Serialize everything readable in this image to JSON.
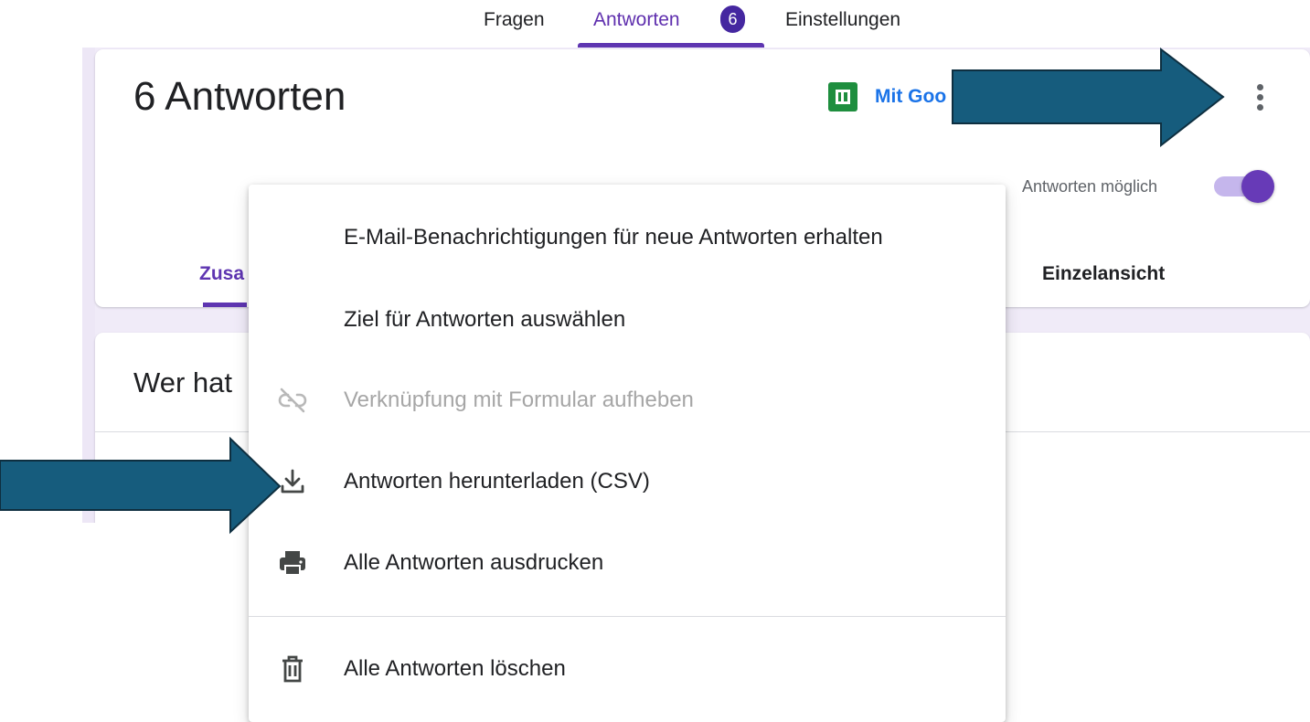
{
  "top_tabs": {
    "questions": "Fragen",
    "responses": "Antworten",
    "responses_count": "6",
    "settings": "Einstellungen"
  },
  "summary_card": {
    "title": "6 Antworten",
    "sheets_link": "Mit Goo",
    "accepting_label": "Antworten möglich",
    "subtab_left": "Zusa",
    "subtab_right": "Einzelansicht"
  },
  "question_card": {
    "title": "Wer hat"
  },
  "menu": {
    "items": [
      {
        "label": "E-Mail-Benachrichtigungen für neue Antworten erhalten",
        "icon": "",
        "disabled": false
      },
      {
        "label": "Ziel für Antworten auswählen",
        "icon": "",
        "disabled": false
      },
      {
        "label": "Verknüpfung mit Formular aufheben",
        "icon": "link-off-icon",
        "disabled": true
      },
      {
        "label": "Antworten herunterladen (CSV)",
        "icon": "download-icon",
        "disabled": false
      },
      {
        "label": "Alle Antworten ausdrucken",
        "icon": "print-icon",
        "disabled": false
      },
      {
        "label": "Alle Antworten löschen",
        "icon": "trash-icon",
        "disabled": false
      }
    ]
  },
  "colors": {
    "accent": "#5e35b1",
    "arrow": "#165c7d",
    "link": "#1a73e8",
    "sheets_green": "#1e8e3e"
  }
}
